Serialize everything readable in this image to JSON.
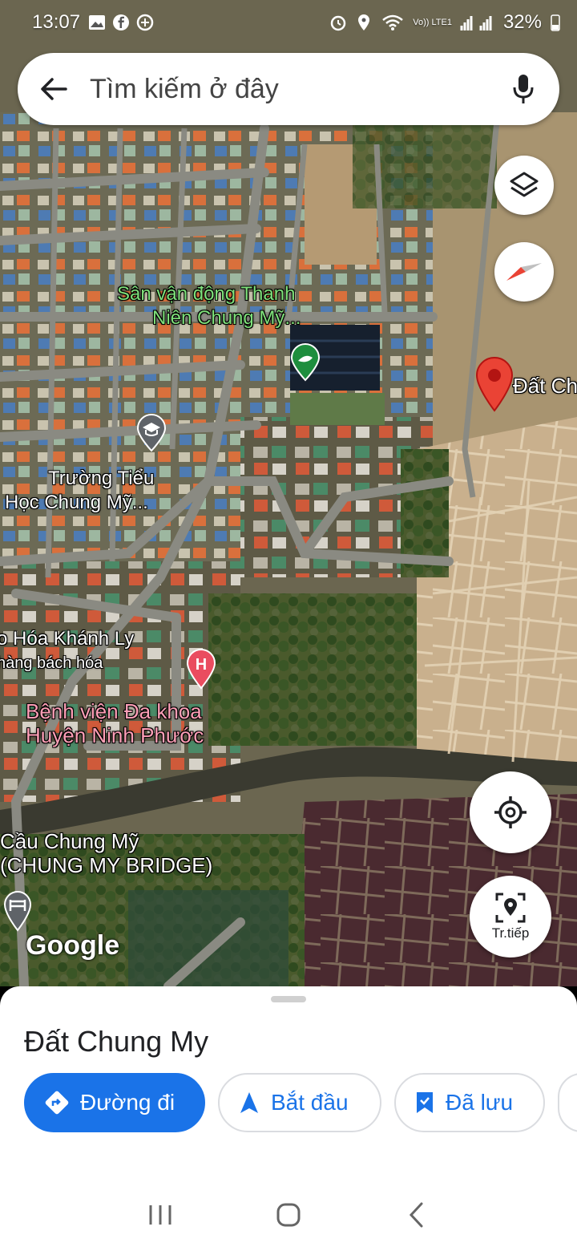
{
  "status_bar": {
    "time": "13:07",
    "battery": "32%",
    "network": "Vo)) LTE1"
  },
  "search": {
    "placeholder": "Tìm kiếm ở đây",
    "back_icon": "arrow-left-icon",
    "mic_icon": "mic-icon"
  },
  "map": {
    "labels": {
      "stadium_line1": "Sân vận động Thanh",
      "stadium_line2": "Niên Chung Mỹ...",
      "school_line1": "Trường Tiểu",
      "school_line2": "Học Chung Mỹ...",
      "store_line1": "o Hóa Khánh Ly",
      "store_line2": "hàng bách hóa",
      "hospital_line1": "Bệnh viện Đa khoa",
      "hospital_line2": "Huyện Ninh Phước",
      "bridge_line1": "Cầu Chung Mỹ",
      "bridge_line2": "(CHUNG MY BRIDGE)",
      "pin_label": "Đất Ch"
    },
    "watermark": "Google",
    "live_view_label": "Tr.tiếp"
  },
  "place": {
    "title": "Đất Chung My",
    "actions": {
      "directions": "Đường đi",
      "start": "Bắt đầu",
      "saved": "Đã lưu"
    }
  },
  "colors": {
    "primary": "#1a73e8",
    "pin": "#ea4335"
  }
}
